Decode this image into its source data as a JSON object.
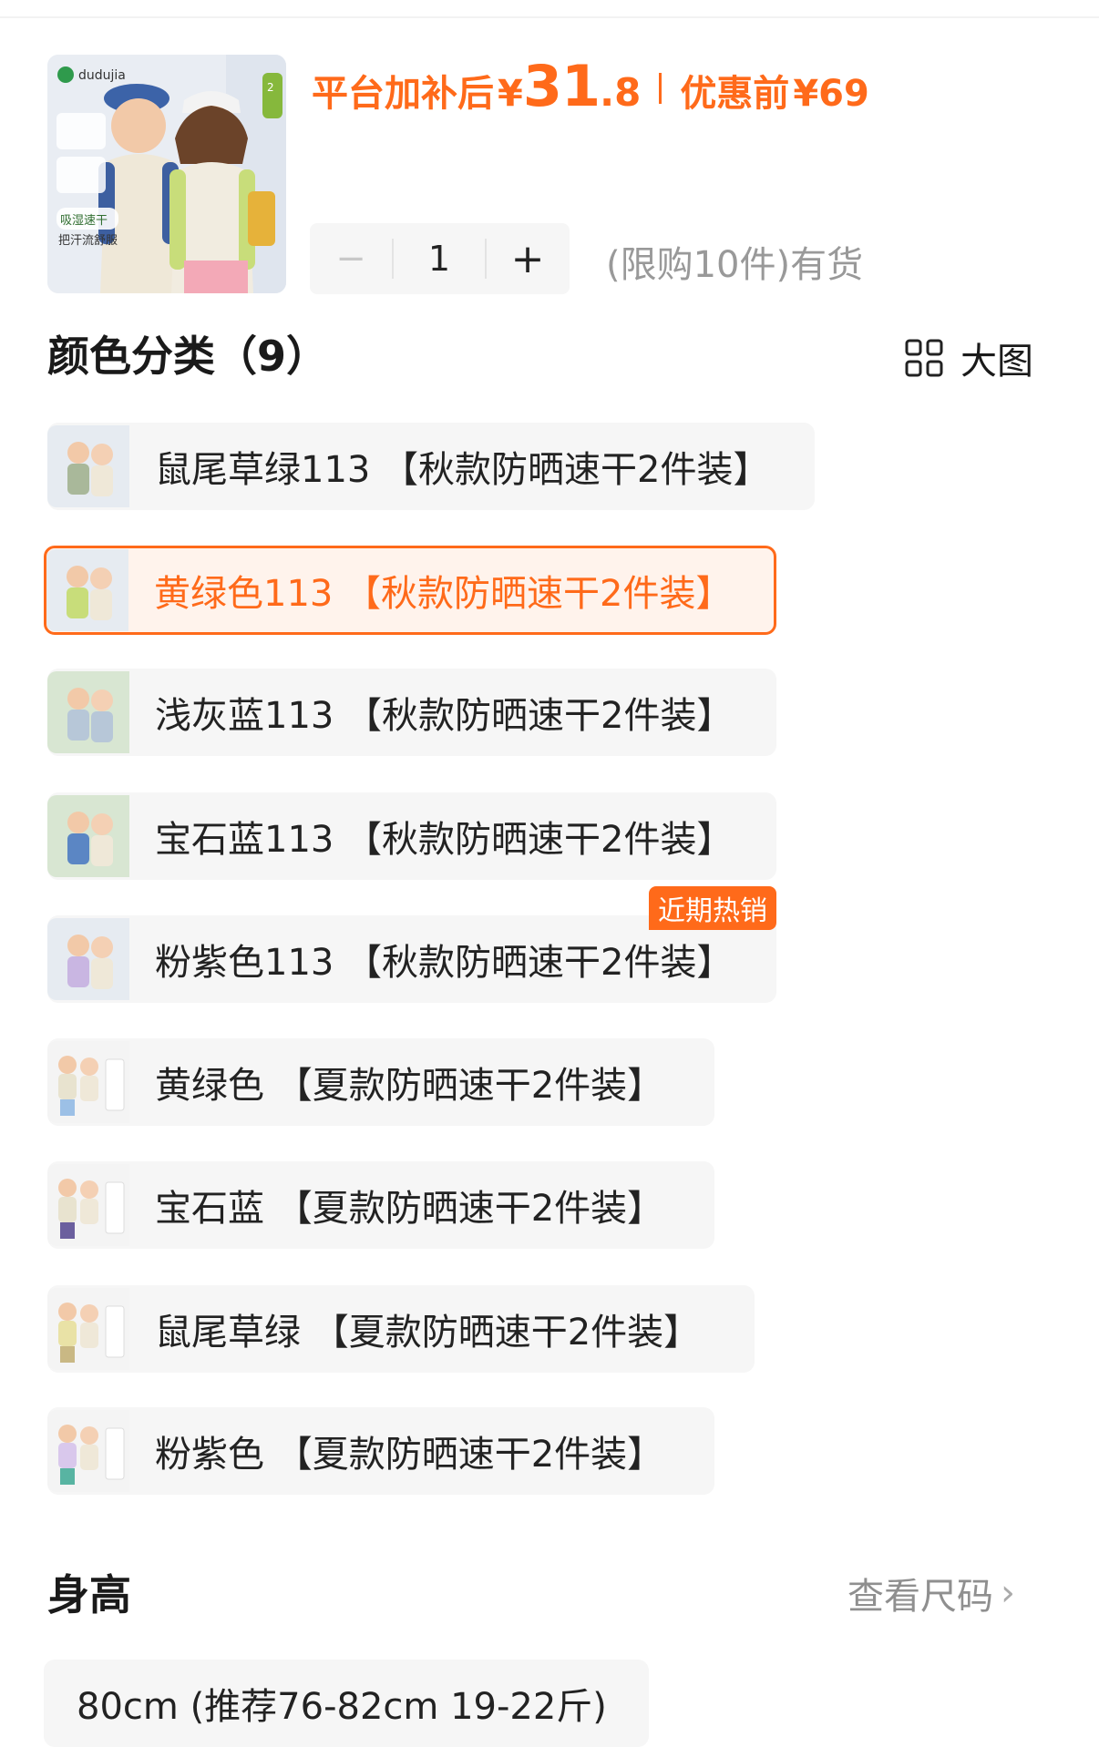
{
  "product": {
    "thumb_brand": "dudujia",
    "thumb_badge": "2件装",
    "thumb_tagline1": "吸湿速干",
    "thumb_tagline2": "把汗流舒服"
  },
  "price": {
    "label": "平台加补后",
    "yen": "¥",
    "integer": "31",
    "decimal": ".8",
    "original_label": "优惠前",
    "original_yen": "¥",
    "original_value": "69",
    "accent_color": "#ff6a1a"
  },
  "quantity": {
    "minus": "−",
    "value": "1",
    "plus": "+",
    "stock_text": "(限购10件)有货"
  },
  "color_section": {
    "title": "颜色分类（9）",
    "big_view_label": "大图",
    "options": [
      {
        "label": "鼠尾草绿113 【秋款防晒速干2件装】",
        "selected": false
      },
      {
        "label": "黄绿色113 【秋款防晒速干2件装】",
        "selected": true
      },
      {
        "label": "浅灰蓝113 【秋款防晒速干2件装】",
        "selected": false
      },
      {
        "label": "宝石蓝113 【秋款防晒速干2件装】",
        "selected": false
      },
      {
        "label": "粉紫色113 【秋款防晒速干2件装】",
        "selected": false,
        "badge": "近期热销"
      },
      {
        "label": "黄绿色 【夏款防晒速干2件装】",
        "selected": false
      },
      {
        "label": "宝石蓝 【夏款防晒速干2件装】",
        "selected": false
      },
      {
        "label": "鼠尾草绿 【夏款防晒速干2件装】",
        "selected": false
      },
      {
        "label": "粉紫色 【夏款防晒速干2件装】",
        "selected": false
      }
    ]
  },
  "height_section": {
    "title": "身高",
    "size_chart_link": "查看尺码",
    "first_option": "80cm (推荐76-82cm 19-22斤)"
  }
}
